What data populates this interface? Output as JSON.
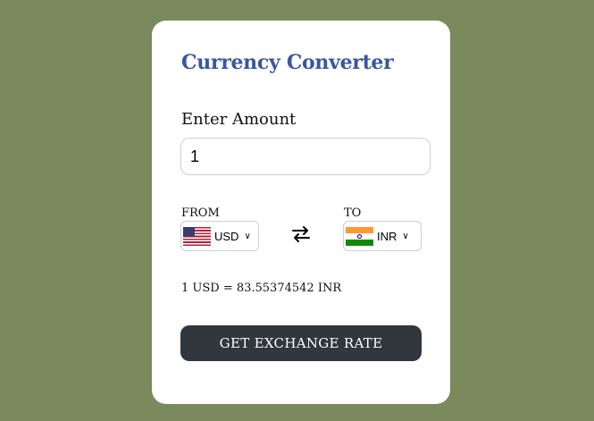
{
  "app": {
    "title": "Currency Converter"
  },
  "amount": {
    "label": "Enter Amount",
    "value": "1"
  },
  "from": {
    "label": "FROM",
    "currency": "USD",
    "flag_icon": "us-flag-icon"
  },
  "to": {
    "label": "TO",
    "currency": "INR",
    "flag_icon": "india-flag-icon"
  },
  "swap": {
    "icon": "swap-arrows-icon"
  },
  "result": {
    "text": "1 USD = 83.55374542 INR"
  },
  "button": {
    "label": "GET EXCHANGE RATE"
  },
  "colors": {
    "background": "#7a8a5c",
    "title": "#3a56a0",
    "button": "#32363d"
  }
}
